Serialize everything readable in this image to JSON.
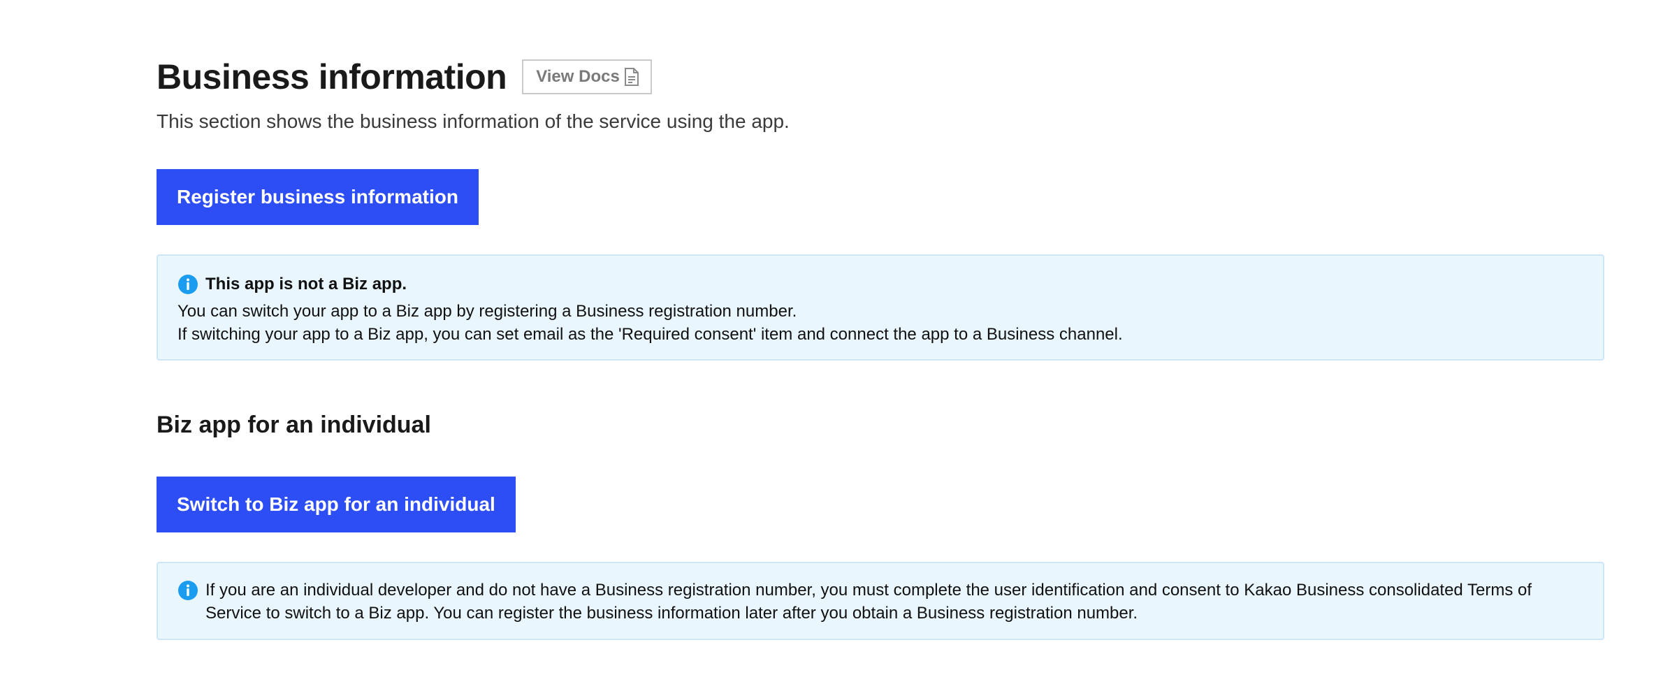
{
  "header": {
    "title": "Business information",
    "docs_label": "View Docs",
    "subtitle": "This section shows the business information of the service using the app."
  },
  "register": {
    "button_label": "Register business information"
  },
  "notice_biz": {
    "heading": "This app is not a Biz app.",
    "line1": "You can switch your app to a Biz app by registering a Business registration number.",
    "line2": "If switching your app to a Biz app, you can set email as the 'Required consent' item and connect the app to a Business channel."
  },
  "individual": {
    "section_title": "Biz app for an individual",
    "button_label": "Switch to Biz app for an individual",
    "notice": "If you are an individual developer and do not have a Business registration number, you must complete the user identification and consent to Kakao Business consolidated Terms of Service to switch to a Biz app. You can register the business information later after you obtain a Business registration number."
  },
  "icons": {
    "info": "info-circle-icon",
    "docs": "document-icon"
  },
  "colors": {
    "primary": "#2e4ef5",
    "info_bg": "#eaf6fd",
    "info_border": "#cfe7f5",
    "info_icon": "#1a9cf0"
  }
}
